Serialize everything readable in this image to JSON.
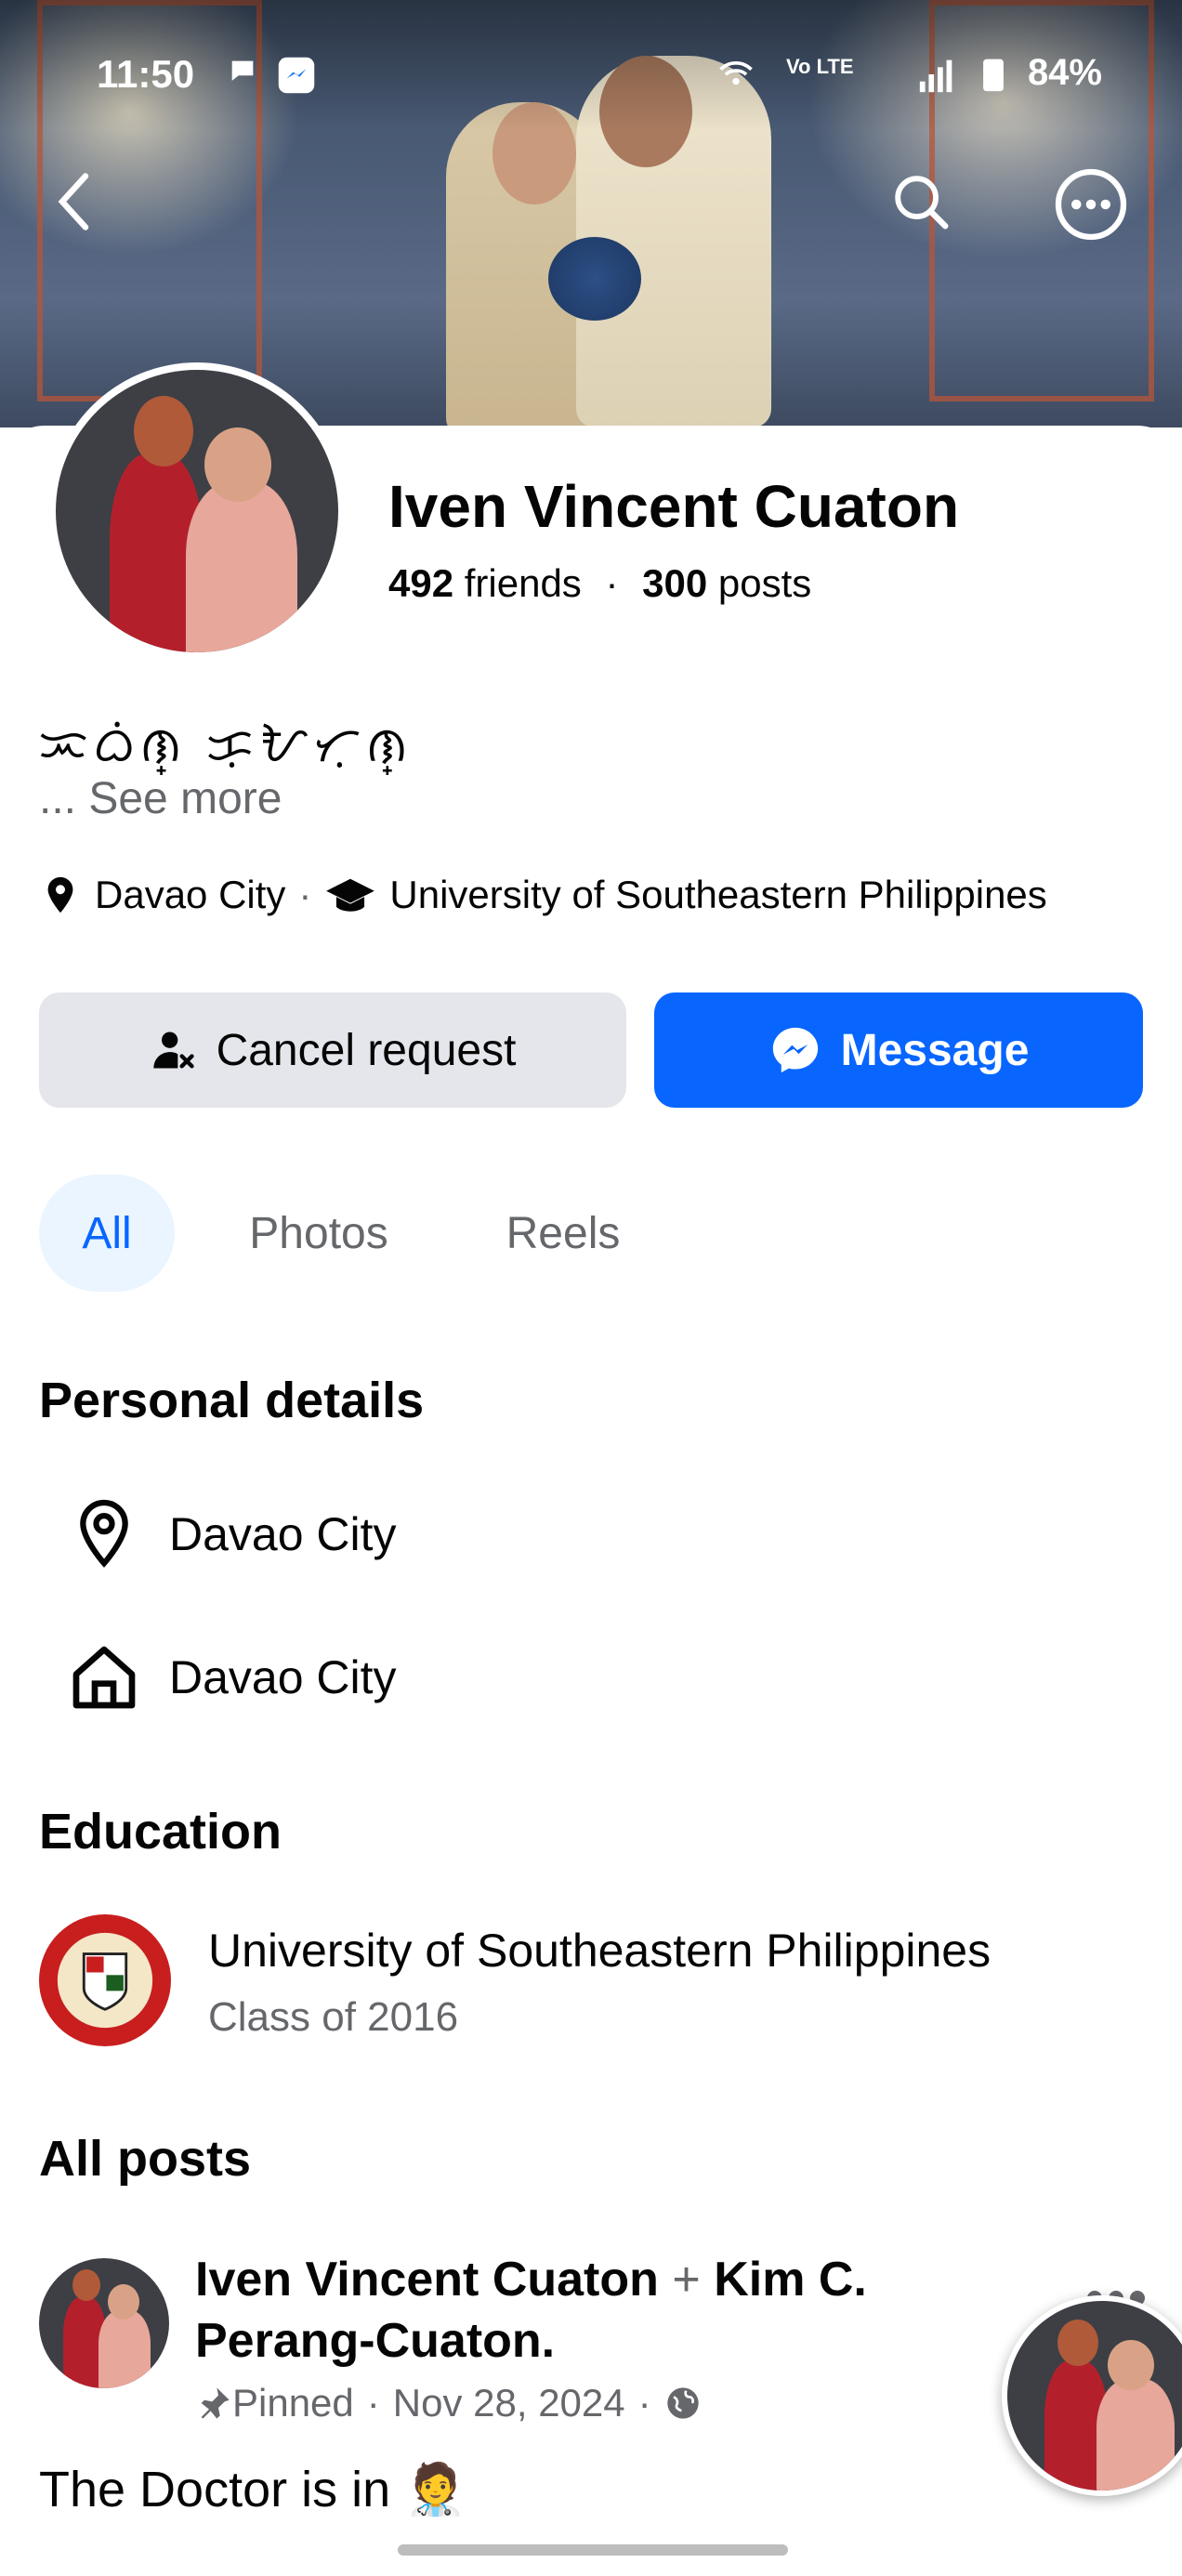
{
  "status_bar": {
    "time": "11:50",
    "network": "Vo LTE",
    "battery": "84%"
  },
  "profile": {
    "name": "Iven Vincent Cuaton",
    "friends_count": "492",
    "friends_label": "friends",
    "separator": "·",
    "posts_count": "300",
    "posts_label": "posts",
    "bio": "ᜁᜊᜒᜈ᜔ ᜃᜓᜀᜆᜓᜈ᜔",
    "see_more": "... See more",
    "location": "Davao City",
    "school": "University of Southeastern Philippines"
  },
  "actions": {
    "cancel_request": "Cancel request",
    "message": "Message"
  },
  "tabs": [
    {
      "label": "All",
      "active": true
    },
    {
      "label": "Photos",
      "active": false
    },
    {
      "label": "Reels",
      "active": false
    }
  ],
  "personal_details": {
    "title": "Personal details",
    "items": [
      {
        "icon": "location-pin-icon",
        "text": "Davao City"
      },
      {
        "icon": "home-icon",
        "text": "Davao City"
      }
    ]
  },
  "education": {
    "title": "Education",
    "school": "University of Southeastern Philippines",
    "class": "Class of 2016"
  },
  "posts": {
    "title": "All posts",
    "first": {
      "author": "Iven Vincent Cuaton",
      "plus": "+",
      "coauthor": "Kim C. Perang-Cuaton.",
      "pinned": "Pinned",
      "dot": "·",
      "date": "Nov 28, 2024",
      "text": "The Doctor is in 🧑‍⚕️"
    }
  },
  "colors": {
    "accent": "#0866ff",
    "secondary_text": "#65676b",
    "button_gray": "#e4e6eb"
  }
}
